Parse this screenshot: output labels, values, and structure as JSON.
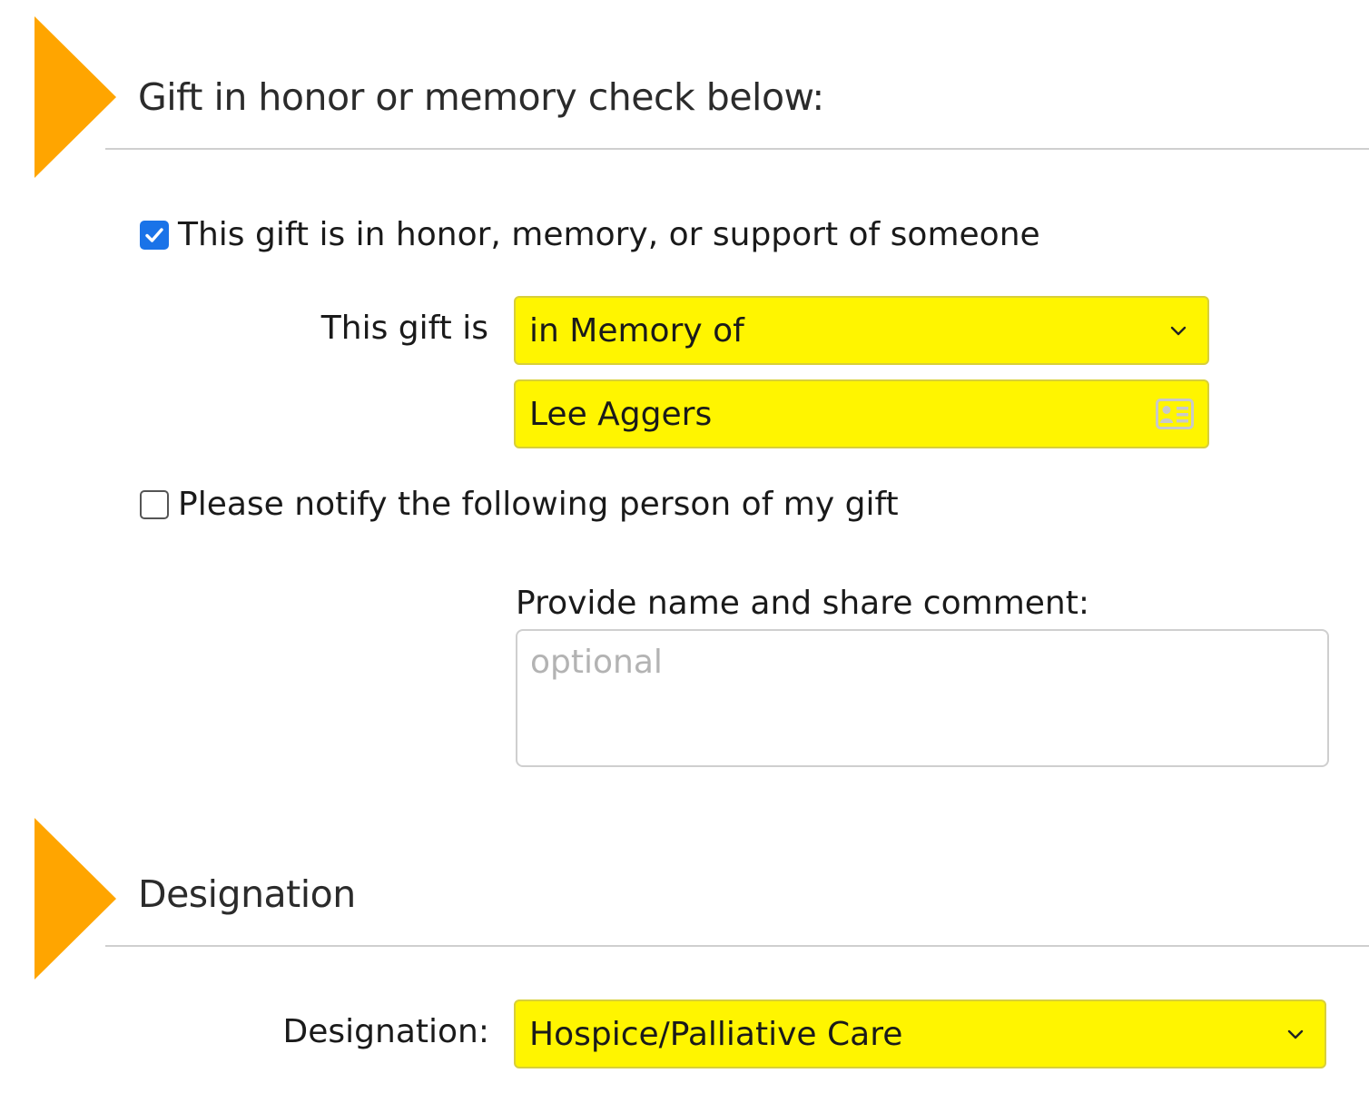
{
  "honor_section": {
    "title": "Gift in honor or memory check below:",
    "honor_checkbox": {
      "checked": true,
      "label": "This gift is in honor, memory, or support of someone"
    },
    "gift_type": {
      "label": "This gift is",
      "selected": "in Memory of"
    },
    "honoree_name": {
      "value": "Lee Aggers"
    },
    "notify_checkbox": {
      "checked": false,
      "label": "Please notify the following person of my gift"
    },
    "comment": {
      "label": "Provide name and share comment:",
      "placeholder": "optional",
      "value": ""
    }
  },
  "designation_section": {
    "title": "Designation",
    "designation": {
      "label": "Designation:",
      "selected": "Hospice/Palliative Care"
    }
  },
  "colors": {
    "accent": "#FFA500",
    "highlight": "#FFF500",
    "checkbox": "#1a73e8",
    "rule": "#cfcfcf"
  },
  "icons": {
    "section_marker": "triangle-right-icon",
    "select_arrow": "chevron-down-icon",
    "contact": "contact-card-icon",
    "checkmark": "checkmark-icon"
  }
}
